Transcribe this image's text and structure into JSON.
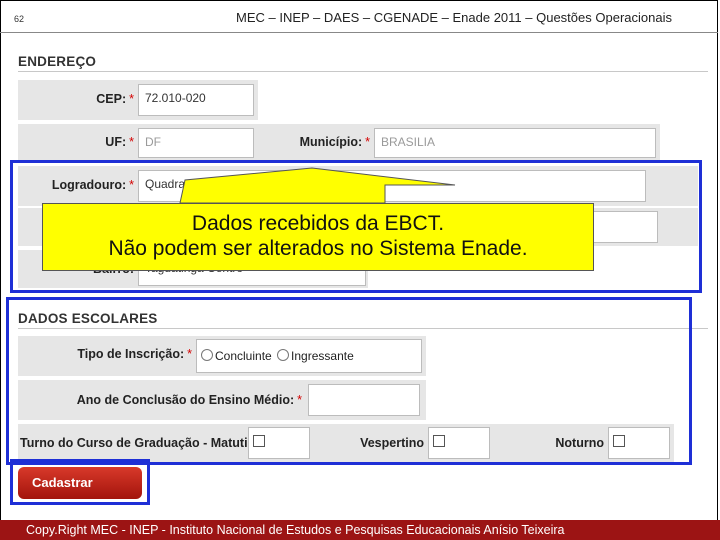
{
  "slide": {
    "number": "62",
    "header": "MEC – INEP – DAES – CGENADE – Enade 2011 – Questões Operacionais",
    "footer": "Copy.Right MEC - INEP - Instituto Nacional de Estudos e Pesquisas Educacionais Anísio Teixeira"
  },
  "endereco": {
    "title": "ENDEREÇO",
    "cep": {
      "label": "CEP:",
      "required": "*",
      "value": "72.010-020"
    },
    "uf": {
      "label": "UF:",
      "required": "*",
      "value": "DF"
    },
    "municipio": {
      "label": "Município:",
      "required": "*",
      "value": "BRASILIA"
    },
    "logradouro": {
      "label": "Logradouro:",
      "required": "*",
      "value": "Quadra C 2"
    },
    "bairro": {
      "label": "Bairro:",
      "value": "Taguatinga Centro"
    }
  },
  "callout": {
    "line1": "Dados recebidos da EBCT.",
    "line2": "Não podem ser alterados no Sistema Enade."
  },
  "dados_escolares": {
    "title": "DADOS ESCOLARES",
    "tipo_inscricao": {
      "label": "Tipo de Inscrição:",
      "required": "*",
      "options": [
        "Concluinte",
        "Ingressante"
      ]
    },
    "ano_conclusao": {
      "label": "Ano de Conclusão do Ensino Médio:",
      "required": "*",
      "value": ""
    },
    "turno": {
      "label": "Turno do Curso de Graduação - Matutino",
      "vespertino": "Vespertino",
      "noturno": "Noturno"
    }
  },
  "actions": {
    "cadastrar": "Cadastrar"
  },
  "colors": {
    "frame_blue": "#1e2fd6",
    "callout_yellow": "#ffff00",
    "footer_red": "#9c1414",
    "button_red": "#c0241a"
  }
}
